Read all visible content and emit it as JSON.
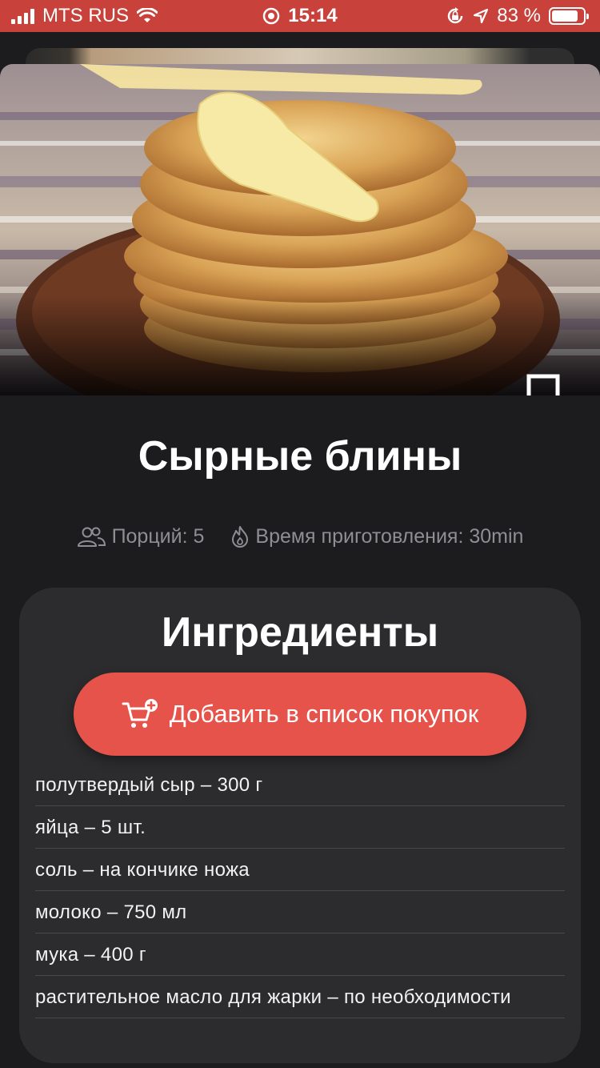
{
  "status_bar": {
    "carrier": "MTS RUS",
    "time": "15:14",
    "battery_percent": "83 %",
    "battery_level": 0.83,
    "color": "#c8413a"
  },
  "recipe": {
    "title": "Сырные блины",
    "servings": "Порций: 5",
    "cook_time": "Время приготовления: 30min",
    "icons": [
      "people-icon",
      "flame-icon",
      "bookmark-icon"
    ]
  },
  "ingredients_panel": {
    "title": "Ингредиенты",
    "add_button_label": "Добавить в список покупок",
    "accent_color": "#e5534b",
    "items": [
      "полутвердый сыр – 300 г",
      "яйца – 5 шт.",
      "соль – на кончике ножа",
      "молоко – 750 мл",
      "мука – 400 г",
      "растительное масло для жарки – по необходимости"
    ]
  }
}
